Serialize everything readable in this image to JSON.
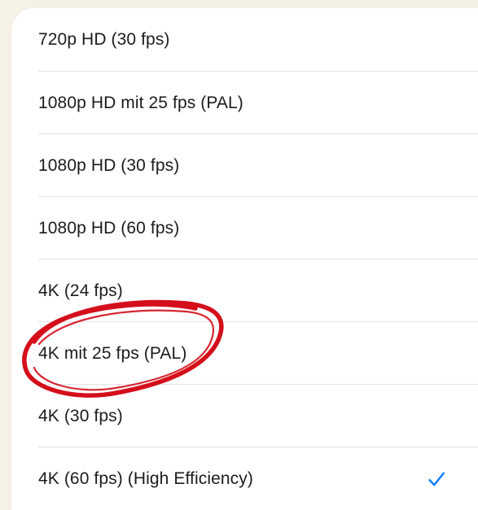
{
  "options": [
    {
      "label": "720p HD (30 fps)",
      "selected": false
    },
    {
      "label": "1080p HD mit 25 fps (PAL)",
      "selected": false
    },
    {
      "label": "1080p HD (30 fps)",
      "selected": false
    },
    {
      "label": "1080p HD (60 fps)",
      "selected": false
    },
    {
      "label": "4K (24 fps)",
      "selected": false
    },
    {
      "label": "4K mit 25 fps (PAL)",
      "selected": false
    },
    {
      "label": "4K (30 fps)",
      "selected": false
    },
    {
      "label": "4K (60 fps) (High Efficiency)",
      "selected": true
    }
  ],
  "icons": {
    "selected": "checkmark-icon"
  },
  "colors": {
    "accent": "#007aff",
    "annotation": "#d40f1b",
    "text": "#1c1c1e",
    "separator": "#e1e1e6"
  }
}
